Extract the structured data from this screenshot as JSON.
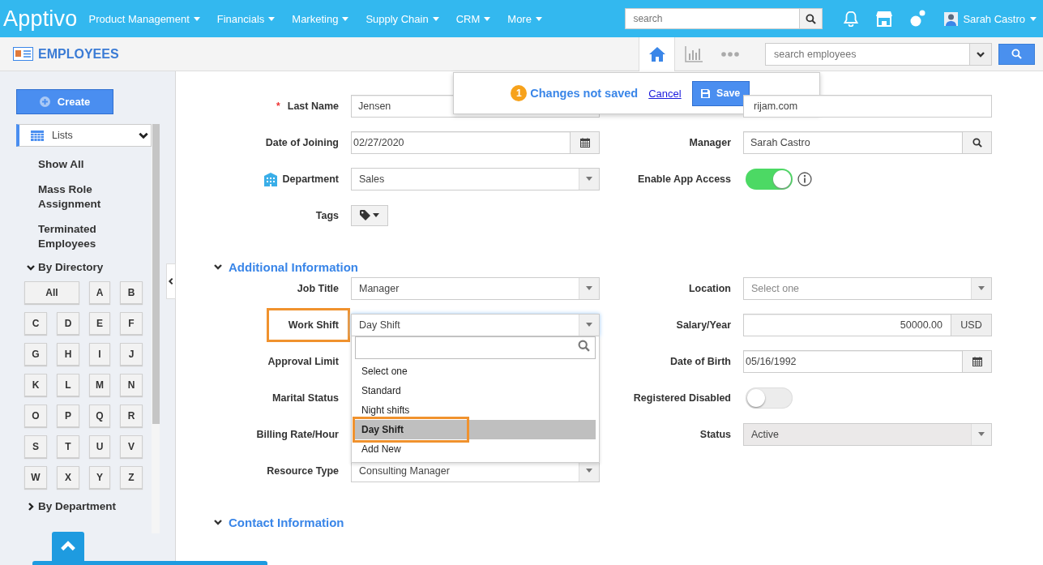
{
  "topbar": {
    "logo": "Apptivo",
    "menu": [
      "Product Management",
      "Financials",
      "Marketing",
      "Supply Chain",
      "CRM",
      "More"
    ],
    "search": {
      "placeholder": "search"
    },
    "user": "Sarah Castro"
  },
  "header": {
    "title": "EMPLOYEES",
    "tabs": [
      {
        "kind": "home",
        "selected": true
      },
      {
        "kind": "reports",
        "selected": false
      },
      {
        "kind": "more",
        "selected": false
      }
    ],
    "search": {
      "placeholder": "search employees"
    }
  },
  "sidebar": {
    "create": "Create",
    "lists": {
      "label": "Lists",
      "expanded": true,
      "selected": true
    },
    "items": [
      "Show All",
      "Mass Role Assignment",
      "Terminated Employees"
    ],
    "directory": {
      "label": "By Directory",
      "expanded": true,
      "letters": [
        "All",
        "A",
        "B",
        "C",
        "D",
        "E",
        "F",
        "G",
        "H",
        "I",
        "J",
        "K",
        "L",
        "M",
        "N",
        "O",
        "P",
        "Q",
        "R",
        "S",
        "T",
        "U",
        "V",
        "W",
        "X",
        "Y",
        "Z"
      ]
    },
    "department": {
      "label": "By Department",
      "expanded": false
    }
  },
  "notice": {
    "count": "1",
    "message": "Changes not saved",
    "cancel": "Cancel",
    "save": "Save"
  },
  "sections": [
    {
      "rows": [
        {
          "left": {
            "label": "Last Name",
            "required_mark": "*",
            "kind": "text",
            "value": "Jensen"
          },
          "right": {
            "kind": "text",
            "value": "rijam.com"
          }
        },
        {
          "left": {
            "label": "Date of Joining",
            "kind": "date",
            "value": "02/27/2020"
          },
          "right": {
            "label": "Manager",
            "kind": "lookup",
            "value": "Sarah Castro"
          }
        },
        {
          "left": {
            "label": "Department",
            "label_icon": true,
            "kind": "select",
            "value": "Sales"
          },
          "right": {
            "label": "Enable App Access",
            "kind": "toggle",
            "on": true,
            "info": true
          }
        },
        {
          "left": {
            "label": "Tags",
            "kind": "tags"
          }
        }
      ]
    },
    {
      "title": "Additional Information",
      "expanded": true,
      "rows": [
        {
          "left": {
            "label": "Job Title",
            "kind": "select",
            "value": "Manager"
          },
          "right": {
            "label": "Location",
            "kind": "select",
            "placeholder": "Select one"
          }
        },
        {
          "left": {
            "label": "Work Shift",
            "kind": "select",
            "value": "Day Shift",
            "highlighted": true,
            "open": true,
            "options": [
              {
                "label": "Select one",
                "selected": false
              },
              {
                "label": "Standard",
                "selected": false
              },
              {
                "label": "Night shifts",
                "selected": false
              },
              {
                "label": "Day Shift",
                "selected": true
              },
              {
                "label": "Add New",
                "selected": false
              }
            ]
          },
          "right": {
            "label": "Salary/Year",
            "kind": "currency",
            "value": "50000.00",
            "unit": "USD"
          }
        },
        {
          "left": {
            "label": "Approval Limit"
          },
          "right": {
            "label": "Date of Birth",
            "kind": "date",
            "value": "05/16/1992"
          }
        },
        {
          "left": {
            "label": "Marital Status"
          },
          "right": {
            "label": "Registered Disabled",
            "kind": "toggle",
            "on": false
          }
        },
        {
          "left": {
            "label": "Billing Rate/Hour"
          },
          "right": {
            "label": "Status",
            "kind": "select",
            "value": "Active",
            "disabled": true
          }
        },
        {
          "left": {
            "label": "Resource Type",
            "kind": "select",
            "value": "Consulting Manager"
          }
        }
      ]
    },
    {
      "title": "Contact Information",
      "expanded": true
    }
  ]
}
